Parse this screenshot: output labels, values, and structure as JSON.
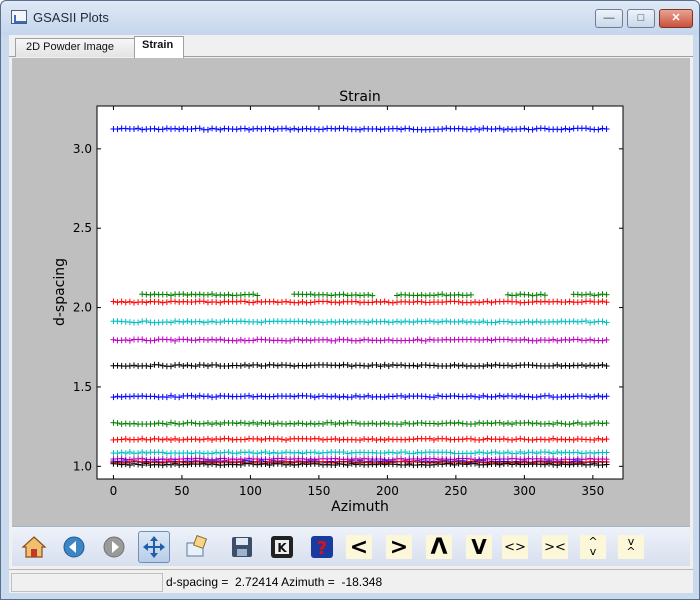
{
  "window": {
    "title": "GSASII Plots"
  },
  "tabs": [
    {
      "label": "2D Powder Image",
      "active": false
    },
    {
      "label": "Strain",
      "active": true
    }
  ],
  "toolbar": {
    "icons": [
      "home-icon",
      "back-icon",
      "forward-icon",
      "pan-icon",
      "zoom-icon",
      "save-icon",
      "key-icon",
      "help-icon"
    ],
    "nav_buttons": [
      "<",
      ">",
      "Λ",
      "V",
      "<>",
      "><",
      "^\nv",
      "v\n^"
    ]
  },
  "status": {
    "text": "d-spacing =  2.72414 Azimuth =  -18.348"
  },
  "chart_data": {
    "type": "scatter",
    "title": "Strain",
    "xlabel": "Azimuth",
    "ylabel": "d-spacing",
    "xlim": [
      -12,
      372
    ],
    "ylim": [
      0.92,
      3.27
    ],
    "xticks": [
      "0",
      "50",
      "100",
      "150",
      "200",
      "250",
      "300",
      "350"
    ],
    "yticks": [
      "1.0",
      "1.5",
      "2.0",
      "2.5",
      "3.0"
    ],
    "marker": "+",
    "grid": false,
    "x_range": [
      0,
      360
    ],
    "series": [
      {
        "color": "#0000ff",
        "y": 3.125,
        "gaps": []
      },
      {
        "color": "#008000",
        "y": 2.08,
        "gaps": [
          [
            0,
            18
          ],
          [
            108,
            130
          ],
          [
            190,
            205
          ],
          [
            262,
            285
          ],
          [
            318,
            335
          ]
        ]
      },
      {
        "color": "#ff0000",
        "y": 2.035,
        "gaps": []
      },
      {
        "color": "#00bfbf",
        "y": 1.91,
        "gaps": []
      },
      {
        "color": "#bf00bf",
        "y": 1.795,
        "gaps": []
      },
      {
        "color": "#000000",
        "y": 1.635,
        "gaps": []
      },
      {
        "color": "#0000ff",
        "y": 1.44,
        "gaps": []
      },
      {
        "color": "#008000",
        "y": 1.27,
        "gaps": []
      },
      {
        "color": "#ff0000",
        "y": 1.17,
        "gaps": []
      },
      {
        "color": "#00bfbf",
        "y": 1.085,
        "gaps": []
      },
      {
        "color": "#bf00bf",
        "y": 1.045,
        "gaps": []
      },
      {
        "color": "#0000ff",
        "y": 1.03,
        "gaps": []
      },
      {
        "color": "#ff0000",
        "y": 1.025,
        "gaps": []
      },
      {
        "color": "#000000",
        "y": 1.012,
        "gaps": []
      }
    ]
  }
}
